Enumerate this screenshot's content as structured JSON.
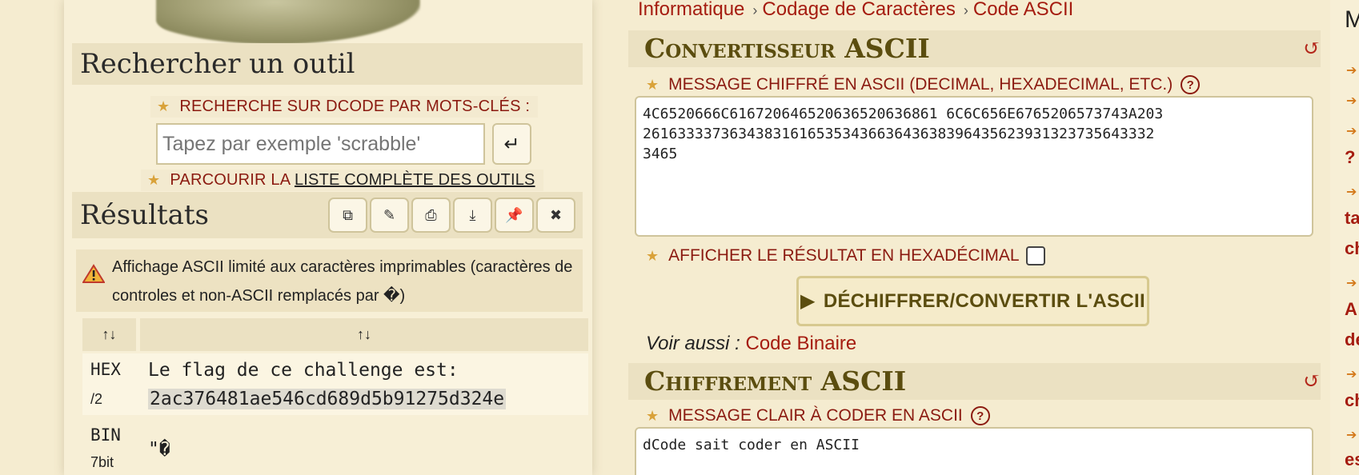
{
  "left": {
    "search": {
      "title": "Rechercher un outil",
      "keywords_label": "RECHERCHE SUR DCODE PAR MOTS-CLÉS :",
      "placeholder": "Tapez par exemple 'scrabble'",
      "browse_prefix": "PARCOURIR LA ",
      "browse_link": "LISTE COMPLÈTE DES OUTILS"
    },
    "results": {
      "title": "Résultats",
      "toolbar_icons": [
        "copy-icon",
        "edit-icon",
        "print-icon",
        "download-icon",
        "pin-icon",
        "close-icon"
      ],
      "warning": "Affichage ASCII limité aux caractères imprimables (caractères de controles et non-ASCII remplacés par �)",
      "sort_header_1": "↑↓",
      "sort_header_2": "↑↓",
      "rows": [
        {
          "label": "HEX",
          "sub": "/2",
          "line1": "Le flag de ce challenge est:",
          "line2": "2ac376481ae546cd689d5b91275d324e"
        },
        {
          "label": "BIN",
          "sub": "7bit",
          "line1": "\"�",
          "line2": ""
        }
      ]
    }
  },
  "right": {
    "breadcrumb": [
      "Informatique",
      "Codage de Caractères",
      "Code ASCII"
    ],
    "converter": {
      "title": "Convertisseur ASCII",
      "input_label": "MESSAGE CHIFFRÉ EN ASCII (DECIMAL, HEXADECIMAL, ETC.)",
      "input_value": "4C6520666C6167206465206365206368616C6C656E6765206573743A2032616333373634383161653534366364363839643562393132373564333234 65",
      "input_lines": [
        "4C6520666C616720646520636520636861 6C6C656E6765206573743A203",
        "26163333736343831616535343663643638396435623931323735643332",
        "3465"
      ],
      "hex_label": "AFFICHER LE RÉSULTAT EN HEXADÉCIMAL",
      "button": "DÉCHIFFRER/CONVERTIR L'ASCII",
      "see_also_prefix": "Voir aussi :",
      "see_also_link": "Code Binaire"
    },
    "encoder": {
      "title": "Chiffrement ASCII",
      "input_label": "MESSAGE CLAIR À CODER EN ASCII",
      "input_value": "dCode sait coder en ASCII"
    }
  },
  "far_right": {
    "letters": [
      "M",
      "?",
      "ta",
      "ch",
      "A",
      "de",
      "ch",
      "es"
    ]
  }
}
